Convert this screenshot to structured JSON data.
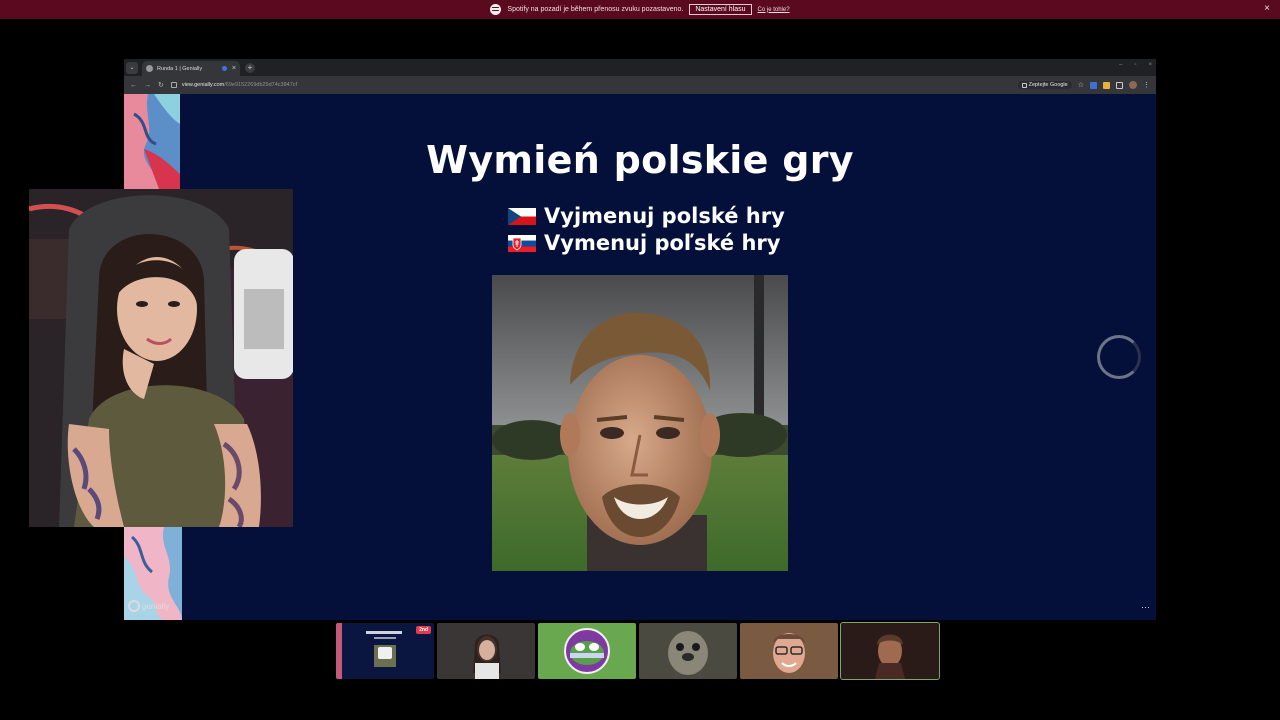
{
  "notification": {
    "message": "Spotify na pozadí je během přenosu zvuku pozastaveno.",
    "button_label": "Nastavení hlasu",
    "link_label": "Co je tohle?",
    "close_icon": "×"
  },
  "browser": {
    "tab_title": "Runda 1 | Genially",
    "new_tab_icon": "+",
    "url_host": "view.genially.com",
    "url_path": "/69e9152269db29d74c3847cf",
    "ask_google_label": "Zeptejte Google",
    "window_controls": [
      "–",
      "▫",
      "×"
    ]
  },
  "slide": {
    "title": "Wymień polskie gry",
    "subtitle_cz": "Vyjmenuj polské hry",
    "subtitle_sk": "Vymenuj poľské hry",
    "brand": "genially"
  },
  "thumbnails": [
    {
      "name": "slide-preview",
      "badge": "2nd"
    },
    {
      "name": "participant-woman"
    },
    {
      "name": "participant-frog-avatar"
    },
    {
      "name": "participant-seal"
    },
    {
      "name": "participant-man-glasses"
    },
    {
      "name": "participant-character"
    }
  ],
  "colors": {
    "slide_bg": "#04103a",
    "notification_bg": "#5a0a1e",
    "accent_green": "#7aa870"
  }
}
